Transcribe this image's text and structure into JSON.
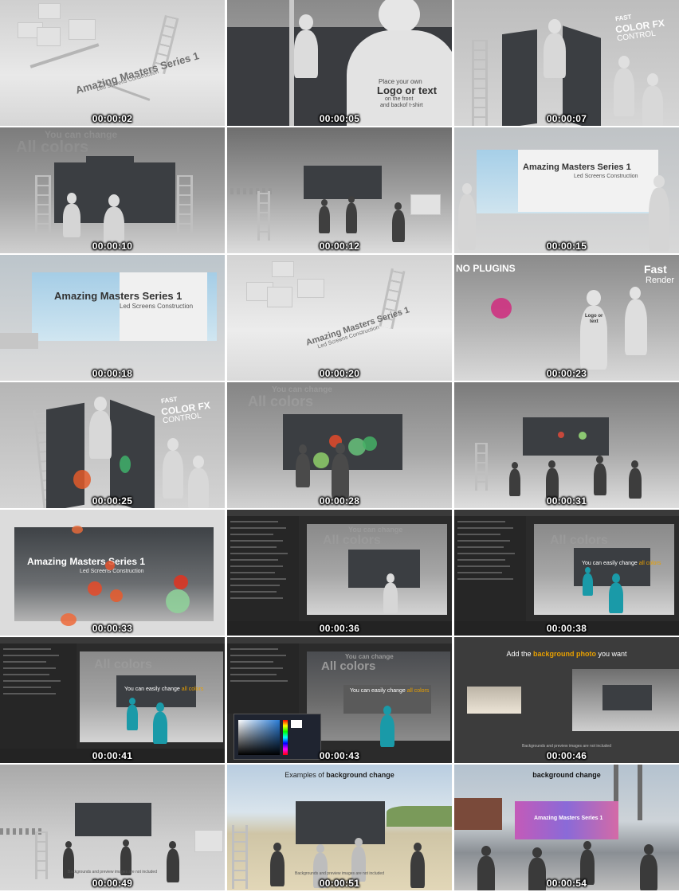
{
  "frames": [
    {
      "time": "00:00:02",
      "texts": {
        "title": "Amazing Masters Series 1",
        "subtitle": "Led Screens Construction"
      }
    },
    {
      "time": "00:00:05",
      "texts": {
        "line1": "Place your own",
        "line2": "Logo or text",
        "line3": "on the front",
        "line4": "and backof t-shirt"
      }
    },
    {
      "time": "00:00:07",
      "texts": {
        "line1": "FAST",
        "line2": "COLOR FX",
        "line3": "CONTROL"
      }
    },
    {
      "time": "00:00:10",
      "texts": {
        "line1": "You can change",
        "line2": "All colors"
      }
    },
    {
      "time": "00:00:12",
      "texts": {}
    },
    {
      "time": "00:00:15",
      "texts": {
        "title": "Amazing Masters Series 1",
        "subtitle": "Led Screens Construction"
      }
    },
    {
      "time": "00:00:18",
      "texts": {
        "title": "Amazing Masters Series 1",
        "subtitle": "Led Screens Construction"
      }
    },
    {
      "time": "00:00:20",
      "texts": {
        "title": "Amazing Masters Series 1",
        "subtitle": "Led Screens Construction"
      }
    },
    {
      "time": "00:00:23",
      "texts": {
        "line1": "NO PLUGINS",
        "line2": "Fast",
        "line3": "Render",
        "logo1": "Logo or",
        "logo2": "text"
      }
    },
    {
      "time": "00:00:25",
      "texts": {
        "line1": "FAST",
        "line2": "COLOR FX",
        "line3": "CONTROL"
      }
    },
    {
      "time": "00:00:28",
      "texts": {
        "line1": "You can change",
        "line2": "All colors"
      }
    },
    {
      "time": "00:00:31",
      "texts": {}
    },
    {
      "time": "00:00:33",
      "texts": {
        "title": "Amazing Masters Series 1",
        "subtitle": "Led Screens Construction"
      }
    },
    {
      "time": "00:00:36",
      "texts": {
        "line1": "You can change",
        "line2": "All colors"
      }
    },
    {
      "time": "00:00:38",
      "texts": {
        "line1": "All colors",
        "caption_pre": "You can easily change ",
        "caption_hl": "all colors"
      }
    },
    {
      "time": "00:00:41",
      "texts": {
        "line1": "All colors",
        "caption_pre": "You can easily change ",
        "caption_hl": "all colors"
      }
    },
    {
      "time": "00:00:43",
      "texts": {
        "line1": "You can change",
        "line2": "All colors",
        "caption_pre": "You can easily change ",
        "caption_hl": "all colors"
      }
    },
    {
      "time": "00:00:46",
      "texts": {
        "header_pre": "Add the ",
        "header_hl": "background photo",
        "header_post": " you want",
        "footnote": "Backgrounds and preview images are not included"
      }
    },
    {
      "time": "00:00:49",
      "texts": {
        "footnote": "Backgrounds and preview images are not included"
      }
    },
    {
      "time": "00:00:51",
      "texts": {
        "header_pre": "Examples of ",
        "header_hl": "background change",
        "footnote": "Backgrounds and preview images are not included"
      }
    },
    {
      "time": "00:00:54",
      "texts": {
        "header": "background change",
        "screen_title": "Amazing Masters Series 1"
      }
    }
  ],
  "colors": {
    "studio_light": "#d8d8d8",
    "studio_mid": "#9a9a9a",
    "screen_dark": "#3b3e42",
    "figure_white": "#dcdcdc",
    "figure_cyan": "#1a9aa8",
    "ae_dark": "#2b2b2b",
    "accent_orange": "#e8a000",
    "stamp_text": "#ffffff"
  }
}
